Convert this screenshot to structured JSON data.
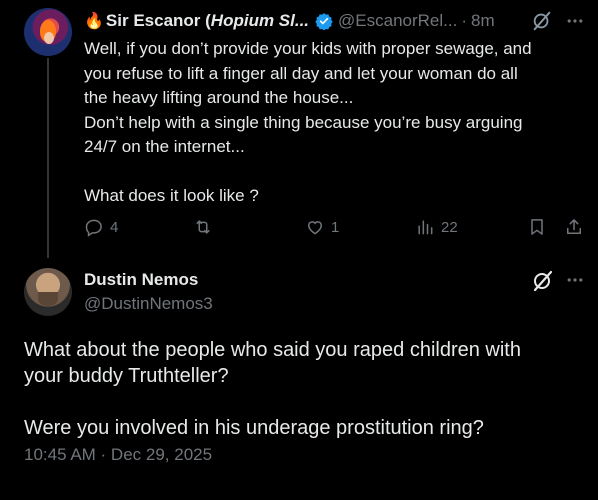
{
  "reply_post": {
    "author_emoji": "🔥",
    "author_name_plain": "Sir Escanor (",
    "author_name_italic": "Hopium Sl...",
    "handle": "@EscanorRel...",
    "separator": "·",
    "time_ago": "8m",
    "text_lines": [
      "Well, if you don’t provide your kids with proper sewage, and",
      "you refuse to lift a finger all day and let your woman do all",
      "the heavy lifting around the house...",
      "Don’t help with a single thing because you’re busy arguing",
      "24/7 on the internet...",
      "",
      "What does it look like ?"
    ],
    "replies_count": "4",
    "reposts_count": "",
    "likes_count": "1",
    "views_count": "22",
    "verified_color": "#1d9bf0",
    "icons": [
      "reply-icon",
      "repost-icon",
      "like-icon",
      "views-icon",
      "bookmark-icon",
      "share-icon",
      "grok-icon",
      "more-icon",
      "verified-icon"
    ]
  },
  "main_post": {
    "author_name": "Dustin Nemos",
    "handle": "@DustinNemos3",
    "text_lines": [
      "What about the people who said you raped children with",
      "your buddy Truthteller?",
      "",
      "Were you involved in his underage prostitution ring?"
    ],
    "timestamp": "10:45 AM · Dec 29, 2025",
    "icons": [
      "grok-icon",
      "more-icon"
    ]
  },
  "colors": {
    "background": "#000000",
    "text": "#e7e9ea",
    "muted": "#71767b",
    "divider": "#333639"
  }
}
